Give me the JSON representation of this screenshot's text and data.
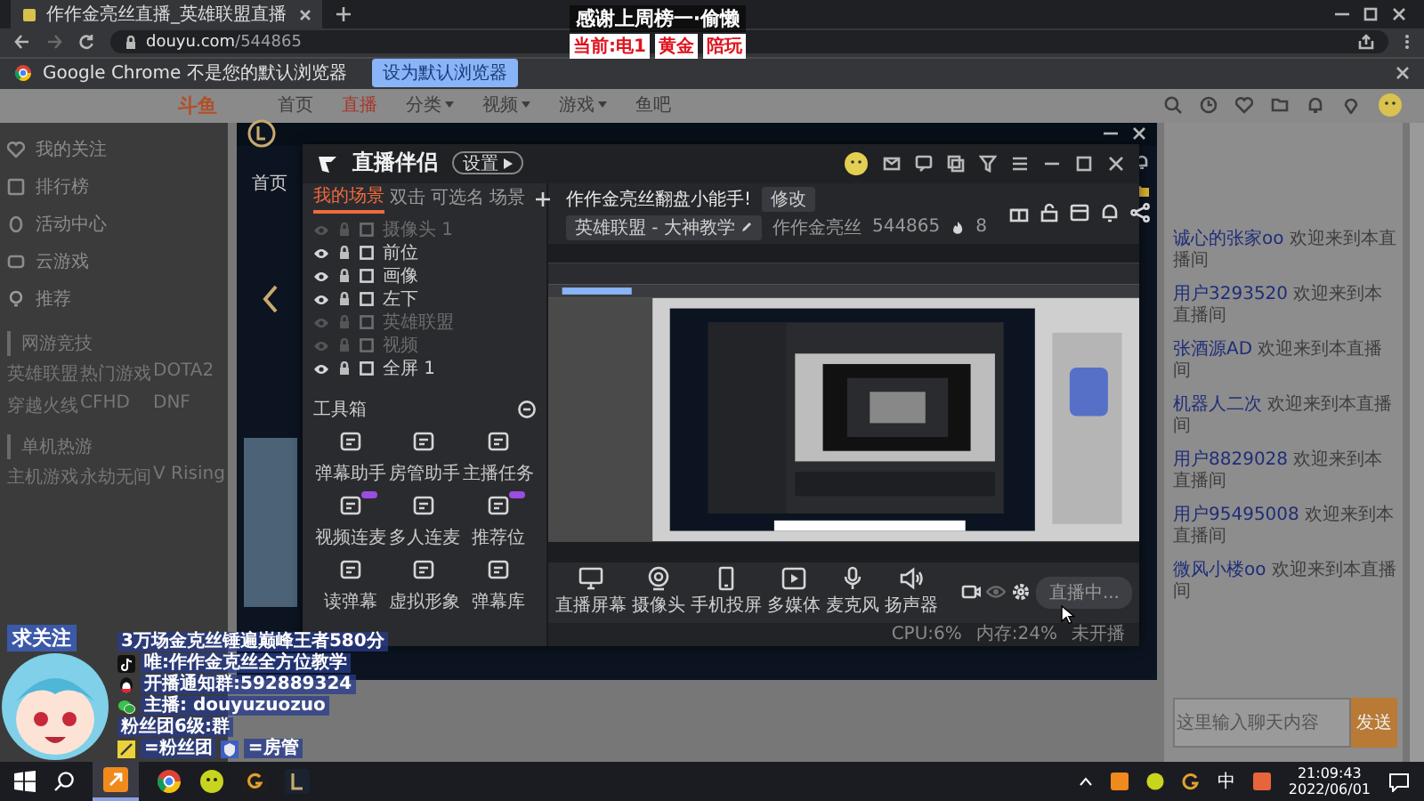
{
  "browser": {
    "tab_title": "作作金亮丝直播_英雄联盟直播",
    "url_host": "douyu.com",
    "url_path": "/544865",
    "notice": "Google Chrome 不是您的默认浏览器",
    "notice_button": "设为默认浏览器"
  },
  "stream_banner": {
    "title": "感谢上周榜一·偷懒",
    "tags": [
      "当前:电1",
      "黄金",
      "陪玩"
    ]
  },
  "site": {
    "logo": "斗鱼",
    "nav": [
      {
        "label": "首页",
        "selected": false,
        "menu": false
      },
      {
        "label": "直播",
        "selected": true,
        "menu": false
      },
      {
        "label": "分类",
        "selected": false,
        "menu": true
      },
      {
        "label": "视频",
        "selected": false,
        "menu": true
      },
      {
        "label": "游戏",
        "selected": false,
        "menu": true
      },
      {
        "label": "鱼吧",
        "selected": false,
        "menu": false
      }
    ]
  },
  "sidebar": {
    "items": [
      "我的关注",
      "排行榜",
      "活动中心",
      "云游戏"
    ],
    "section": "推荐",
    "groups": [
      {
        "title": "网游竞技",
        "games": [
          "英雄联盟",
          "热门游戏",
          "DOTA2",
          "穿越火线",
          "CFHD",
          "DNF"
        ]
      },
      {
        "title": "单机热游",
        "games": [
          "主机游戏",
          "永劫无间",
          "V Rising"
        ]
      }
    ]
  },
  "lol_client": {
    "nav": "首页"
  },
  "companion": {
    "title": "直播伴侣",
    "badge": "设置",
    "scene_tabs": [
      {
        "label": "我的场景",
        "selected": true
      },
      {
        "label": "双击",
        "selected": false
      },
      {
        "label": "可选名",
        "selected": false
      },
      {
        "label": "场景",
        "selected": false
      }
    ],
    "sources": [
      {
        "name": "摄像头 1",
        "visible": false
      },
      {
        "name": "前位",
        "visible": true
      },
      {
        "name": "画像",
        "visible": true
      },
      {
        "name": "左下",
        "visible": true
      },
      {
        "name": "英雄联盟",
        "visible": false
      },
      {
        "name": "视频",
        "visible": false
      },
      {
        "name": "全屏 1",
        "visible": true
      }
    ],
    "toolbox_title": "工具箱",
    "tools": [
      {
        "label": "弹幕助手",
        "tag": false
      },
      {
        "label": "房管助手",
        "tag": false
      },
      {
        "label": "主播任务",
        "tag": false
      },
      {
        "label": "视频连麦",
        "tag": true
      },
      {
        "label": "多人连麦",
        "tag": false
      },
      {
        "label": "推荐位",
        "tag": true
      },
      {
        "label": "读弹幕",
        "tag": false
      },
      {
        "label": "虚拟形象",
        "tag": false
      },
      {
        "label": "弹幕库",
        "tag": false
      }
    ],
    "room_title": "作作金亮丝翻盘小能手!",
    "edit_button": "修改",
    "category": "英雄联盟 - 大神教学",
    "streamer": "作作金亮丝",
    "room_id": "544865",
    "hot": "8",
    "controls": [
      {
        "kind": "screen",
        "label": "直播屏幕"
      },
      {
        "kind": "camera",
        "label": "摄像头"
      },
      {
        "kind": "phone",
        "label": "手机投屏"
      },
      {
        "kind": "media",
        "label": "多媒体"
      },
      {
        "kind": "mic",
        "label": "麦克风"
      },
      {
        "kind": "speaker",
        "label": "扬声器"
      }
    ],
    "live_button": "直播中...",
    "status": [
      "CPU:6%",
      "内存:24%",
      "未开播"
    ]
  },
  "chat": {
    "messages": [
      {
        "user": "诚心的张家oo",
        "text": "欢迎来到本直播间"
      },
      {
        "user": "用户3293520",
        "text": "欢迎来到本直播间"
      },
      {
        "user": "张酒源AD",
        "text": "欢迎来到本直播间"
      },
      {
        "user": "机器人二次",
        "text": "欢迎来到本直播间"
      },
      {
        "user": "用户8829028",
        "text": "欢迎来到本直播间"
      },
      {
        "user": "用户95495008",
        "text": "欢迎来到本直播间"
      },
      {
        "user": "微风小楼oo",
        "text": "欢迎来到本直播间"
      }
    ],
    "input_placeholder": "这里输入聊天内容",
    "send_button": "发送"
  },
  "overlay": {
    "follow": "求关注",
    "lines": [
      {
        "kind": "plain",
        "text": "3万场金克丝锤遍巅峰王者580分"
      },
      {
        "kind": "tiktok",
        "text": "唯:作作金克丝全方位教学"
      },
      {
        "kind": "qq",
        "text": "开播通知群:592889324"
      },
      {
        "kind": "wechat",
        "text": "主播: douyuzuozuo"
      },
      {
        "kind": "plain",
        "text": "粉丝团6级:群"
      }
    ],
    "roles": [
      "=粉丝团",
      "=房管"
    ]
  },
  "taskbar": {
    "ime": "中",
    "time": "21:09:43",
    "date": "2022/06/01"
  }
}
